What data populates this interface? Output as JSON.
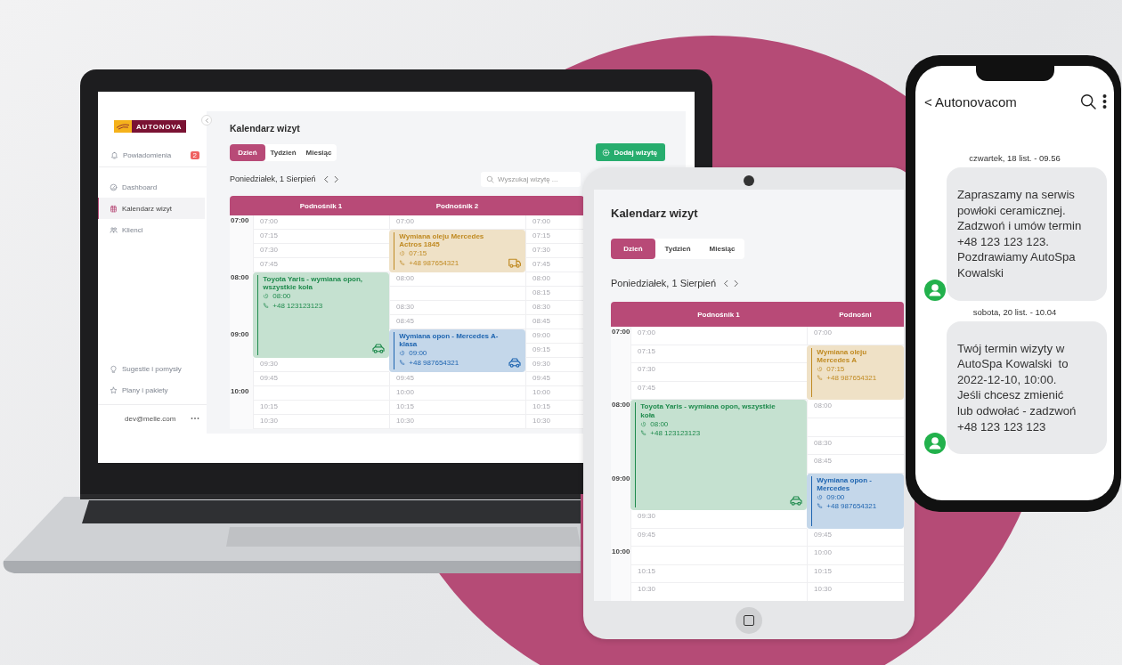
{
  "laptop": {
    "sidebar": {
      "logo": "AUTONOVA",
      "notifications": {
        "label": "Powiadomienia",
        "badge": "2"
      },
      "nav": [
        {
          "label": "Dashboard",
          "kind": "gauge",
          "selected": false
        },
        {
          "label": "Kalendarz wizyt",
          "kind": "calendar",
          "selected": true
        },
        {
          "label": "Klienci",
          "kind": "people",
          "selected": false
        }
      ],
      "bottom": [
        {
          "label": "Sugestie i pomysły",
          "kind": "bulb"
        },
        {
          "label": "Plany i pakiety",
          "kind": "star"
        }
      ],
      "user": "dev@melle.com"
    },
    "title": "Kalendarz wizyt",
    "tabs": [
      {
        "label": "Dzień",
        "selected": true
      },
      {
        "label": "Tydzień",
        "selected": false
      },
      {
        "label": "Miesiąc",
        "selected": false
      }
    ],
    "add_button": "Dodaj wizytę",
    "date": "Poniedziałek, 1 Sierpień",
    "search": {
      "placeholder": "Wyszukaj wizytę ..."
    },
    "calendar": {
      "hours": [
        "07:00",
        "08:00",
        "09:00",
        "10:00"
      ],
      "columns": [
        {
          "header": "Podnośnik 1",
          "cells": [
            {
              "kind": "slot",
              "time": "07:00"
            },
            {
              "kind": "slot",
              "time": "07:15"
            },
            {
              "kind": "slot",
              "time": "07:30"
            },
            {
              "kind": "slot",
              "time": "07:45"
            },
            {
              "kind": "car",
              "title": "Toyota Yaris - wymiana opon, wszystkie koła",
              "time": "08:00",
              "phone": "+48 123123123",
              "color": "#1e8a4c"
            },
            {
              "kind": "slot",
              "time": "09:30"
            },
            {
              "kind": "slot",
              "time": "09:45"
            },
            {
              "kind": "slot"
            },
            {
              "kind": "slot",
              "time": "10:15"
            },
            {
              "kind": "slot",
              "time": "10:30"
            }
          ]
        },
        {
          "header": "Podnośnik 2",
          "cells": [
            {
              "kind": "slot",
              "time": "07:00"
            },
            {
              "kind": "truck",
              "title": "Wymiana oleju Mercedes Actros 1845",
              "time": "07:15",
              "phone": "+48 987654321",
              "color": "#c08a22"
            },
            {
              "kind": "slot",
              "time": "08:00"
            },
            {
              "kind": "slot"
            },
            {
              "kind": "slot",
              "time": "08:30"
            },
            {
              "kind": "slot",
              "time": "08:45"
            },
            {
              "kind": "car",
              "title": "Wymiana opon - Mercedes A-klasa",
              "time": "09:00",
              "phone": "+48 987654321",
              "color": "#1d64b0"
            },
            {
              "kind": "slot",
              "time": "09:45"
            },
            {
              "kind": "slot",
              "time": "10:00"
            },
            {
              "kind": "slot",
              "time": "10:15"
            },
            {
              "kind": "slot",
              "time": "10:30"
            }
          ]
        },
        {
          "cells": [
            {
              "kind": "slot",
              "time": "07:00"
            },
            {
              "kind": "slot",
              "time": "07:15"
            },
            {
              "kind": "slot",
              "time": "07:30"
            },
            {
              "kind": "slot",
              "time": "07:45"
            },
            {
              "kind": "slot",
              "time": "08:00"
            },
            {
              "kind": "slot",
              "time": "08:15"
            },
            {
              "kind": "slot",
              "time": "08:30"
            },
            {
              "kind": "slot",
              "time": "08:45"
            },
            {
              "kind": "slot",
              "time": "09:00"
            },
            {
              "kind": "slot",
              "time": "09:15"
            },
            {
              "kind": "slot",
              "time": "09:30"
            },
            {
              "kind": "slot",
              "time": "09:45"
            },
            {
              "kind": "slot",
              "time": "10:00"
            },
            {
              "kind": "slot",
              "time": "10:15"
            },
            {
              "kind": "slot",
              "time": "10:30"
            }
          ]
        }
      ]
    }
  },
  "tablet": {
    "title": "Kalendarz wizyt",
    "tabs": [
      {
        "label": "Dzień",
        "selected": true
      },
      {
        "label": "Tydzień",
        "selected": false
      },
      {
        "label": "Miesiąc",
        "selected": false
      }
    ],
    "date": "Poniedziałek, 1 Sierpień",
    "calendar": {
      "hours": [
        "07:00",
        "08:00",
        "09:00",
        "10:00"
      ],
      "columns": [
        {
          "header": "Podnośnik 1",
          "cells": [
            {
              "kind": "slot",
              "time": "07:00"
            },
            {
              "kind": "slot",
              "time": "07:15"
            },
            {
              "kind": "slot",
              "time": "07:30"
            },
            {
              "kind": "slot",
              "time": "07:45"
            },
            {
              "kind": "car",
              "title": "Toyota Yaris - wymiana opon, wszystkie koła",
              "time": "08:00",
              "phone": "+48 123123123",
              "color": "#1e8a4c"
            },
            {
              "kind": "slot",
              "time": "09:30"
            },
            {
              "kind": "slot",
              "time": "09:45"
            },
            {
              "kind": "slot"
            },
            {
              "kind": "slot",
              "time": "10:15"
            },
            {
              "kind": "slot",
              "time": "10:30"
            }
          ]
        },
        {
          "header": "Podnośni",
          "cells": [
            {
              "kind": "slot",
              "time": "07:00"
            },
            {
              "kind": "event",
              "title": "Wymiana oleju Mercedes A",
              "time": "07:15",
              "phone": "+48 987654321",
              "color": "#c08a22"
            },
            {
              "kind": "slot",
              "time": "08:00"
            },
            {
              "kind": "slot"
            },
            {
              "kind": "slot",
              "time": "08:30"
            },
            {
              "kind": "slot",
              "time": "08:45"
            },
            {
              "kind": "event",
              "title": "Wymiana opon - Mercedes",
              "time": "09:00",
              "phone": "+48 987654321",
              "color": "#1d64b0"
            },
            {
              "kind": "slot",
              "time": "09:45"
            },
            {
              "kind": "slot",
              "time": "10:00"
            },
            {
              "kind": "slot",
              "time": "10:15"
            },
            {
              "kind": "slot",
              "time": "10:30"
            }
          ]
        }
      ]
    }
  },
  "phone": {
    "contact": "< Autonovacom",
    "messages": [
      {
        "date": "czwartek, 18 list. -  09.56",
        "text": "Zapraszamy na serwis\npowłoki ceramicznej.\nZadzwoń i umów termin\n+48 123 123 123.\nPozdrawiamy AutoSpa\nKowalski"
      },
      {
        "date": "sobota, 20 list. -  10.04",
        "text": "Twój termin wizyty w\nAutoSpa Kowalski  to\n2022-12-10, 10:00.\nJeśli chcesz zmienić\nlub odwołać - zadzwoń\n+48 123 123 123"
      }
    ]
  }
}
